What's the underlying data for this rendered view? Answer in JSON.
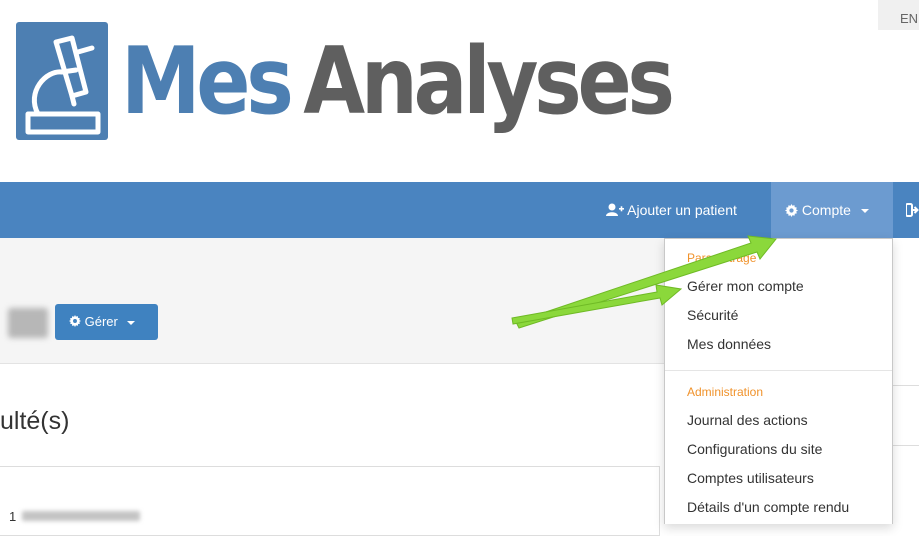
{
  "header": {
    "logo_word1": "Mes",
    "logo_word2": "Analyses",
    "logo_icon": "microscope-icon",
    "lang_label": "EN"
  },
  "navbar": {
    "add_patient_label": "Ajouter un patient",
    "add_patient_icon": "user-plus-icon",
    "account_label": "Compte",
    "account_icon": "gear-icon",
    "exit_icon": "sign-out-icon"
  },
  "content": {
    "manage_label": "Gérer",
    "manage_icon": "gear-icon",
    "results_title": "ulté(s)",
    "row_number": "1"
  },
  "dropdown": {
    "section1_header": "Paramétrage",
    "section1_items": [
      "Gérer mon compte",
      "Sécurité",
      "Mes données"
    ],
    "section2_header": "Administration",
    "section2_items": [
      "Journal des actions",
      "Configurations du site",
      "Comptes utilisateurs",
      "Détails d'un compte rendu"
    ]
  },
  "colors": {
    "brand_blue": "#4d7fb2",
    "logo_gray": "#5f5f5f",
    "navbar_blue": "#4a84c0",
    "navbar_active": "#6c9bd0",
    "dropdown_header": "#f0922b",
    "arrow_green": "#8bd83b"
  }
}
